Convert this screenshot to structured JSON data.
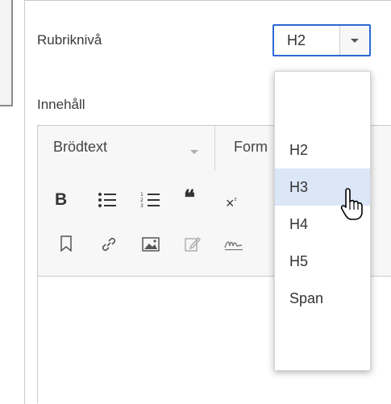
{
  "heading_level": {
    "label": "Rubriknivå",
    "selected": "H2"
  },
  "content": {
    "label": "Innehåll"
  },
  "toolbar": {
    "paragraph_format": "Brödtext",
    "format_label": "Form",
    "icons": [
      "bold-icon",
      "bulleted-list-icon",
      "numbered-list-icon",
      "blockquote-icon",
      "superscript-icon",
      "bookmark-icon",
      "link-icon",
      "image-icon",
      "edit-icon",
      "signature-icon"
    ]
  },
  "dropdown": {
    "options": [
      "H2",
      "H3",
      "H4",
      "H5",
      "Span"
    ],
    "highlighted": "H3"
  },
  "colors": {
    "accent": "#2b68d6",
    "highlight": "#dbe6f7"
  }
}
